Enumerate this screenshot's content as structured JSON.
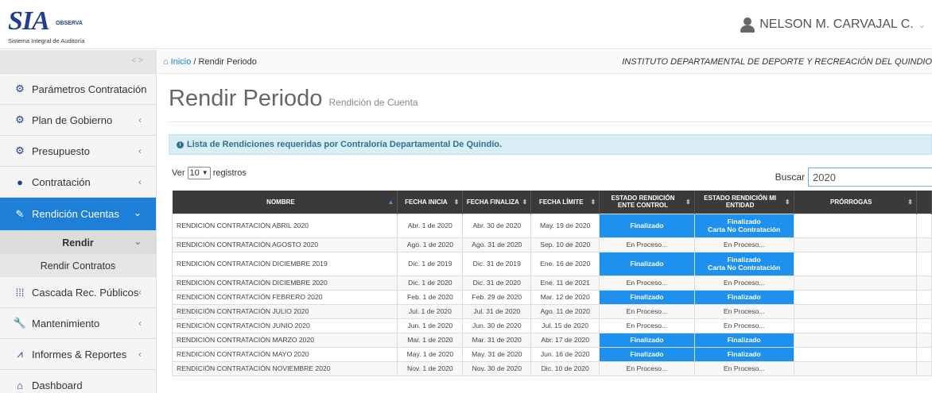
{
  "logo": {
    "mark": "SIA",
    "observa": "OBSERVA",
    "subtitle": "Sistema Integral de Auditoría"
  },
  "user": {
    "name": "NELSON M. CARVAJAL C."
  },
  "sidebar": {
    "toggle": "< >",
    "items": [
      {
        "label": "Parámetros Contratación",
        "icon": "gears-icon"
      },
      {
        "label": "Plan de Gobierno",
        "icon": "gears-icon"
      },
      {
        "label": "Presupuesto",
        "icon": "gears-icon"
      },
      {
        "label": "Contratación",
        "icon": "circle-icon"
      },
      {
        "label": "Rendición Cuentas",
        "icon": "edit-icon"
      },
      {
        "label": "Rendir",
        "icon": ""
      },
      {
        "label": "Rendir Contratos",
        "icon": ""
      },
      {
        "label": "Cascada Rec. Públicos",
        "icon": "grid-icon"
      },
      {
        "label": "Mantenimiento",
        "icon": "wrench-icon"
      },
      {
        "label": "Informes & Reportes",
        "icon": "line-chart-icon"
      },
      {
        "label": "Dashboard",
        "icon": "home-icon"
      }
    ]
  },
  "breadcrumb": {
    "home": "Inicio",
    "sep": " / ",
    "current": "Rendir Periodo",
    "entity": "INSTITUTO DEPARTAMENTAL DE DEPORTE Y RECREACIÓN DEL QUINDIO"
  },
  "page": {
    "title": "Rendir Periodo",
    "subtitle": "Rendición de Cuenta"
  },
  "alert": {
    "text": "Lista de Rendiciones requeridas por Contraloría Departamental De Quindío."
  },
  "table_controls": {
    "show": "Ver",
    "length": "10",
    "records": "registros",
    "search_label": "Buscar",
    "search_value": "2020"
  },
  "table": {
    "headers": [
      "NOMBRE",
      "FECHA INICIA",
      "FECHA FINALIZA",
      "FECHA LÍMITE",
      "ESTADO RENDICIÓN ENTE CONTROL",
      "ESTADO RENDICIÓN MI ENTIDAD",
      "PRÓRROGAS"
    ],
    "rows": [
      {
        "nombre": "RENDICIÓN CONTRATACIÓN ABRIL 2020",
        "inicia": "Abr. 1 de 2020",
        "finaliza": "Abr. 30 de 2020",
        "limite": "May. 19 de 2020",
        "ente": "Finalizado",
        "entidad": "Finalizado",
        "entidad2": "Carta No Contratación"
      },
      {
        "nombre": "RENDICIÓN CONTRATACIÓN AGOSTO 2020",
        "inicia": "Ago. 1 de 2020",
        "finaliza": "Ago. 31 de 2020",
        "limite": "Sep. 10 de 2020",
        "ente": "En Proceso...",
        "entidad": "En Proceso...",
        "entidad2": ""
      },
      {
        "nombre": "RENDICIÓN CONTRATACIÓN DICIEMBRE 2019",
        "inicia": "Dic. 1 de 2019",
        "finaliza": "Dic. 31 de 2019",
        "limite": "Ene. 16 de 2020",
        "ente": "Finalizado",
        "entidad": "Finalizado",
        "entidad2": "Carta No Contratación"
      },
      {
        "nombre": "RENDICIÓN CONTRATACIÓN DICIEMBRE 2020",
        "inicia": "Dic. 1 de 2020",
        "finaliza": "Dic. 31 de 2020",
        "limite": "Ene. 11 de 2021",
        "ente": "En Proceso...",
        "entidad": "En Proceso...",
        "entidad2": ""
      },
      {
        "nombre": "RENDICIÓN CONTRATACIÓN FEBRERO 2020",
        "inicia": "Feb. 1 de 2020",
        "finaliza": "Feb. 29 de 2020",
        "limite": "Mar. 12 de 2020",
        "ente": "Finalizado",
        "entidad": "Finalizado",
        "entidad2": ""
      },
      {
        "nombre": "RENDICIÓN CONTRATACIÓN JULIO 2020",
        "inicia": "Jul. 1 de 2020",
        "finaliza": "Jul. 31 de 2020",
        "limite": "Ago. 11 de 2020",
        "ente": "En Proceso...",
        "entidad": "En Proceso...",
        "entidad2": ""
      },
      {
        "nombre": "RENDICIÓN CONTRATACIÓN JUNIO 2020",
        "inicia": "Jun. 1 de 2020",
        "finaliza": "Jun. 30 de 2020",
        "limite": "Jul. 15 de 2020",
        "ente": "En Proceso...",
        "entidad": "En Proceso...",
        "entidad2": ""
      },
      {
        "nombre": "RENDICIÓN CONTRATACIÓN MARZO 2020",
        "inicia": "Mar. 1 de 2020",
        "finaliza": "Mar. 31 de 2020",
        "limite": "Abr. 17 de 2020",
        "ente": "Finalizado",
        "entidad": "Finalizado",
        "entidad2": ""
      },
      {
        "nombre": "RENDICIÓN CONTRATACIÓN MAYO 2020",
        "inicia": "May. 1 de 2020",
        "finaliza": "May. 31 de 2020",
        "limite": "Jun. 16 de 2020",
        "ente": "Finalizado",
        "entidad": "Finalizado",
        "entidad2": ""
      },
      {
        "nombre": "RENDICIÓN CONTRATACIÓN NOVIEMBRE 2020",
        "inicia": "Nov. 1 de 2020",
        "finaliza": "Nov. 30 de 2020",
        "limite": "Dic. 10 de 2020",
        "ente": "En Proceso...",
        "entidad": "En Proceso...",
        "entidad2": ""
      }
    ]
  },
  "colors": {
    "accent": "#1e7fd9",
    "finalizado": "#1e90ee",
    "header": "#3a3a3a",
    "alert_bg": "#d9edf7"
  }
}
